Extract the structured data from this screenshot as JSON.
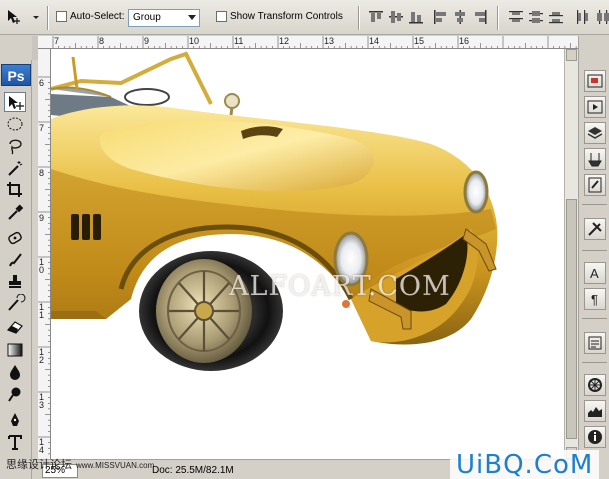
{
  "options_bar": {
    "auto_select_label": "Auto-Select:",
    "auto_select_value": "Group",
    "show_transform_label": "Show Transform Controls",
    "auto_select_checked": false,
    "show_transform_checked": false
  },
  "toolbox": {
    "logo": "Ps",
    "tools": [
      "move-icon",
      "marquee-icon",
      "lasso-icon",
      "magic-wand-icon",
      "crop-icon",
      "eyedropper-icon",
      "healing-icon",
      "brush-icon",
      "clone-stamp-icon",
      "history-brush-icon",
      "eraser-icon",
      "gradient-icon",
      "blur-icon",
      "dodge-icon",
      "pen-icon",
      "type-icon"
    ]
  },
  "rulers": {
    "top_numbers": [
      "7",
      "8",
      "9",
      "10",
      "11",
      "12",
      "13",
      "14",
      "15",
      "16"
    ],
    "left_numbers": [
      "6",
      "7",
      "8",
      "9",
      "1 0",
      "1 1",
      "1 2",
      "1 3",
      "1 4"
    ]
  },
  "canvas": {
    "watermark": "ALFOART.COM"
  },
  "status": {
    "zoom": "25%",
    "doc": "Doc: 25.5M/82.1M"
  },
  "dock": {
    "icons": [
      "navigator-icon",
      "actions-icon",
      "layers-icon",
      "tool-presets-icon",
      "brushes-icon",
      "styles-icon",
      "character-icon",
      "paragraph-icon",
      "notes-icon",
      "color-wheel-icon",
      "histogram-icon",
      "info-icon"
    ]
  },
  "overlays": {
    "site_left": "思缘设计论坛",
    "site_left_url": "www.MISSVUAN.com",
    "site_right": "UiBQ.CoM"
  },
  "colors": {
    "gold_light": "#f6dc7a",
    "gold_mid": "#d9a82c",
    "gold_dark": "#8a6412",
    "ps_blue": "#2a65b5",
    "uibq_blue": "#1d7fd0"
  }
}
